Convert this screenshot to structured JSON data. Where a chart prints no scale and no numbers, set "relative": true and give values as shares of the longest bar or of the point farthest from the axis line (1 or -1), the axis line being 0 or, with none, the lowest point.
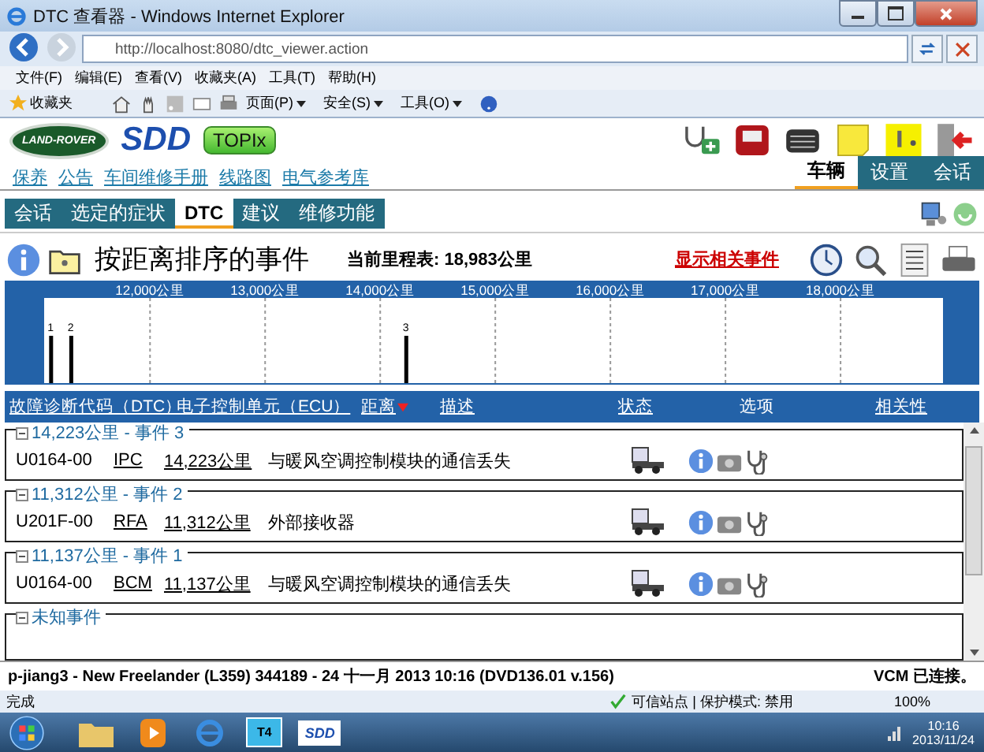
{
  "window": {
    "title": "DTC 查看器 - Windows Internet Explorer"
  },
  "browser": {
    "url": "http://localhost:8080/dtc_viewer.action",
    "menu": [
      "文件(F)",
      "编辑(E)",
      "查看(V)",
      "收藏夹(A)",
      "工具(T)",
      "帮助(H)"
    ],
    "favorites": "收藏夹",
    "commands": [
      "页面(P)",
      "安全(S)",
      "工具(O)"
    ]
  },
  "app": {
    "logo": "LAND-ROVER",
    "product": "SDD",
    "topix": "TOPIx",
    "links": [
      "保养",
      "公告",
      "车间维修手册",
      "线路图",
      "电气参考库"
    ],
    "main_tabs": [
      {
        "label": "车辆",
        "selected": true
      },
      {
        "label": "设置",
        "selected": false
      },
      {
        "label": "会话",
        "selected": false
      }
    ],
    "sub_tabs": [
      {
        "label": "会话",
        "selected": false
      },
      {
        "label": "选定的症状",
        "selected": false
      },
      {
        "label": "DTC",
        "selected": true
      },
      {
        "label": "建议",
        "selected": false
      },
      {
        "label": "维修功能",
        "selected": false
      }
    ],
    "heading": "按距离排序的事件",
    "odometer": "当前里程表: 18,983公里",
    "related_link": "显示相关事件",
    "chart_data": {
      "type": "bar",
      "x": [
        11137,
        11312,
        14223
      ],
      "values": [
        1,
        1,
        1
      ],
      "annotations": [
        "1",
        "2",
        "3"
      ],
      "grid": true,
      "relative": true,
      "xlim": [
        11080,
        18890
      ],
      "xticks": [
        {
          "value": 12000,
          "label": "12,000公里"
        },
        {
          "value": 13000,
          "label": "13,000公里"
        },
        {
          "value": 14000,
          "label": "14,000公里"
        },
        {
          "value": 15000,
          "label": "15,000公里"
        },
        {
          "value": 16000,
          "label": "16,000公里"
        },
        {
          "value": 17000,
          "label": "17,000公里"
        },
        {
          "value": 18000,
          "label": "18,000公里"
        }
      ]
    },
    "columns": [
      {
        "label": "故障诊断代码（DTC）",
        "link": true,
        "sorted": false
      },
      {
        "label": "电子控制单元（ECU）",
        "link": true,
        "sorted": false
      },
      {
        "label": "距离",
        "link": true,
        "sorted": true
      },
      {
        "label": "描述",
        "link": true,
        "sorted": false
      },
      {
        "label": "状态",
        "link": true,
        "sorted": false
      },
      {
        "label": "选项",
        "link": false,
        "sorted": false
      },
      {
        "label": "相关性",
        "link": true,
        "sorted": false
      }
    ],
    "events": [
      {
        "title": "14,223公里 - 事件 3",
        "expanded": true,
        "dtc": "U0164-00",
        "ecu": "IPC",
        "distance": "14,223公里",
        "description": "与暖风空调控制模块的通信丢失"
      },
      {
        "title": "11,312公里 - 事件 2",
        "expanded": true,
        "dtc": "U201F-00",
        "ecu": "RFA",
        "distance": "11,312公里",
        "description": "外部接收器"
      },
      {
        "title": "11,137公里 - 事件 1",
        "expanded": true,
        "dtc": "U0164-00",
        "ecu": "BCM",
        "distance": "11,137公里",
        "description": "与暖风空调控制模块的通信丢失"
      },
      {
        "title": "未知事件",
        "expanded": true
      }
    ],
    "session": "p-jiang3 - New Freelander (L359) 344189 - 24 十一月 2013 10:16 (DVD136.01 v.156)",
    "vcm": "VCM 已连接。"
  },
  "status_bar": {
    "text": "完成",
    "zone": "可信站点 | 保护模式: 禁用",
    "zoom": "100%"
  },
  "taskbar": {
    "sdd": "SDD",
    "t4": "T4",
    "time": "10:16",
    "date": "2013/11/24"
  }
}
